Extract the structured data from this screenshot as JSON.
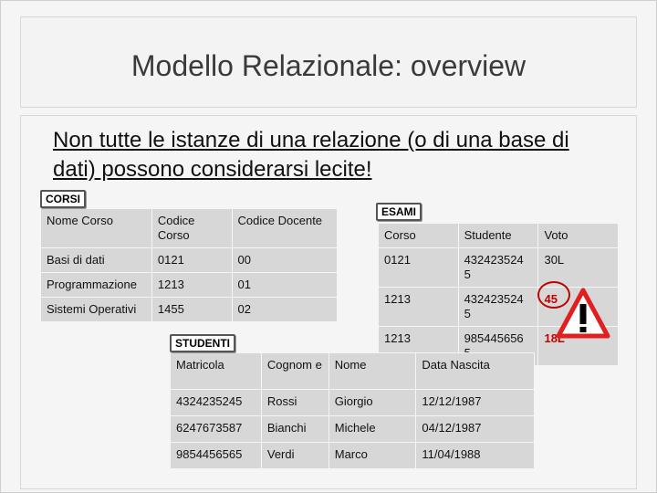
{
  "title": "Modello Relazionale: overview",
  "subtitle": "Non tutte le istanze di una relazione (o di una base di dati) possono considerarsi lecite!",
  "corsi": {
    "label": "CORSI",
    "headers": [
      "Nome Corso",
      "Codice Corso",
      "Codice Docente"
    ],
    "rows": [
      [
        "Basi di dati",
        "0121",
        "00"
      ],
      [
        "Programmazione",
        "1213",
        "01"
      ],
      [
        "Sistemi Operativi",
        "1455",
        "02"
      ]
    ]
  },
  "esami": {
    "label": "ESAMI",
    "headers": [
      "Corso",
      "Studente",
      "Voto"
    ],
    "rows": [
      [
        "0121",
        "432423524 5",
        "30L"
      ],
      [
        "1213",
        "432423524 5",
        "45"
      ],
      [
        "1213",
        "985445656 5",
        "18L"
      ]
    ]
  },
  "studenti": {
    "label": "STUDENTI",
    "headers": [
      "Matricola",
      "Cognom e",
      "Nome",
      "Data Nascita"
    ],
    "rows": [
      [
        "4324235245",
        "Rossi",
        "Giorgio",
        "12/12/1987"
      ],
      [
        "6247673587",
        "Bianchi",
        "Michele",
        "04/12/1987"
      ],
      [
        "9854456565",
        "Verdi",
        "Marco",
        "11/04/1988"
      ]
    ]
  },
  "warning_icon": "warning-triangle-icon",
  "colors": {
    "highlight": "#c00000",
    "cell": "#d7d7d7"
  }
}
